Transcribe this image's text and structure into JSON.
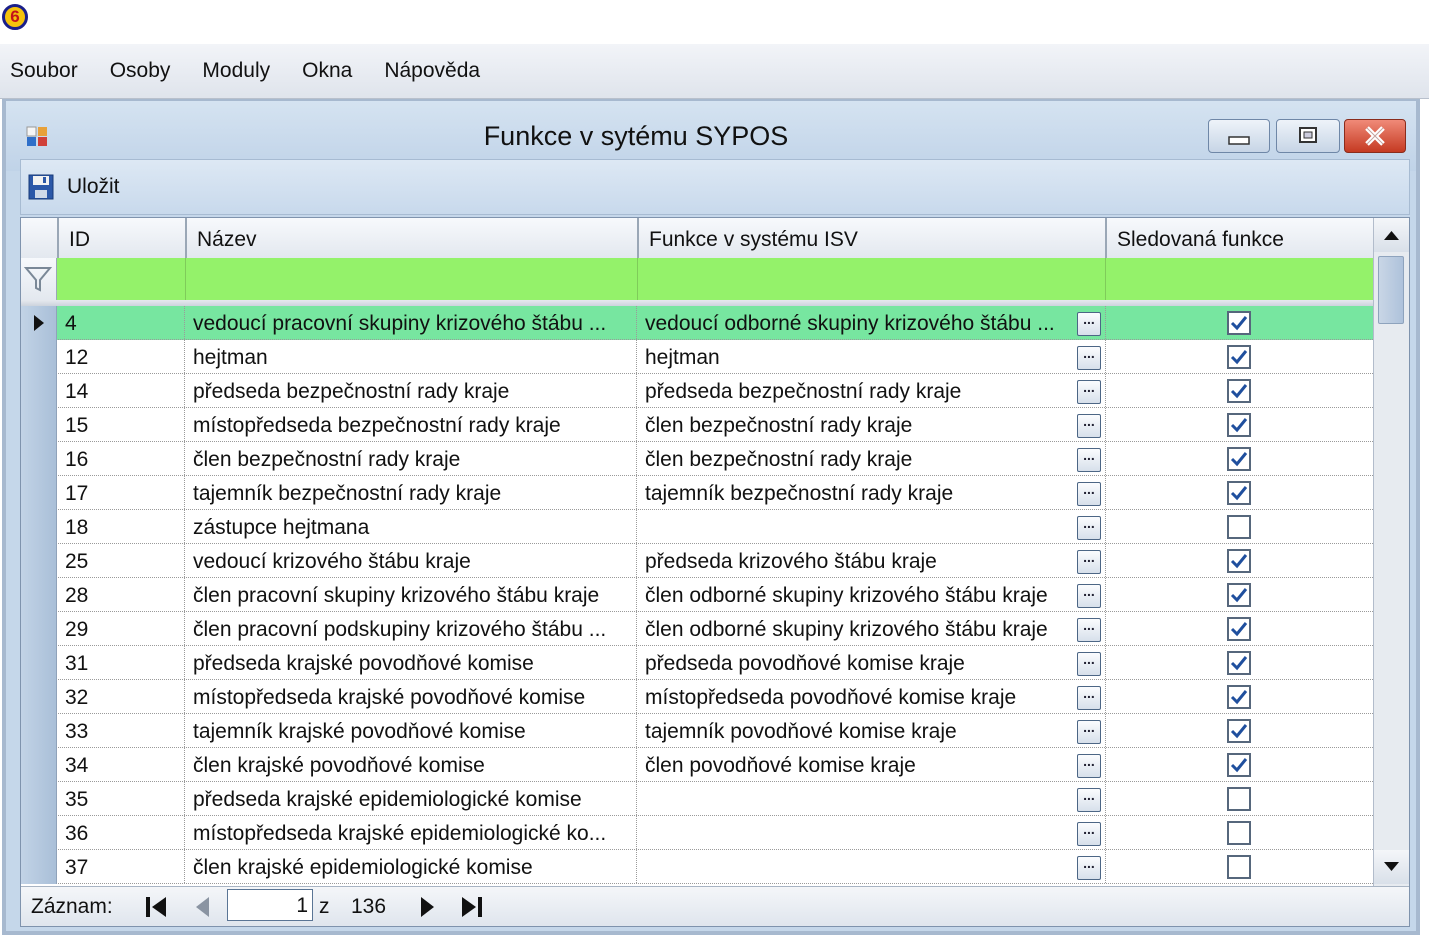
{
  "app": {
    "badge": "6"
  },
  "menu": [
    "Soubor",
    "Osoby",
    "Moduly",
    "Okna",
    "Nápověda"
  ],
  "window": {
    "title": "Funkce v sytému SYPOS"
  },
  "toolbar": {
    "save_label": "Uložit"
  },
  "grid": {
    "columns": [
      "ID",
      "Název",
      "Funkce v systému ISV",
      "Sledovaná funkce"
    ],
    "rows": [
      {
        "id": "4",
        "name": "vedoucí pracovní skupiny krizového štábu ...",
        "isv": "vedoucí odborné skupiny krizového štábu ...",
        "tracked": true,
        "selected": true
      },
      {
        "id": "12",
        "name": "hejtman",
        "isv": "hejtman",
        "tracked": true
      },
      {
        "id": "14",
        "name": "předseda bezpečnostní rady kraje",
        "isv": "předseda bezpečnostní rady kraje",
        "tracked": true
      },
      {
        "id": "15",
        "name": "místopředseda bezpečnostní rady kraje",
        "isv": "člen bezpečnostní rady kraje",
        "tracked": true
      },
      {
        "id": "16",
        "name": "člen bezpečnostní rady kraje",
        "isv": "člen bezpečnostní rady kraje",
        "tracked": true
      },
      {
        "id": "17",
        "name": "tajemník bezpečnostní rady kraje",
        "isv": "tajemník bezpečnostní rady kraje",
        "tracked": true
      },
      {
        "id": "18",
        "name": "zástupce hejtmana",
        "isv": "",
        "tracked": false
      },
      {
        "id": "25",
        "name": "vedoucí krizového štábu kraje",
        "isv": "předseda krizového štábu kraje",
        "tracked": true
      },
      {
        "id": "28",
        "name": "člen pracovní skupiny krizového štábu kraje",
        "isv": "člen odborné skupiny krizového štábu kraje",
        "tracked": true
      },
      {
        "id": "29",
        "name": "člen pracovní podskupiny krizového štábu ...",
        "isv": "člen odborné skupiny krizového štábu kraje",
        "tracked": true
      },
      {
        "id": "31",
        "name": "předseda krajské povodňové komise",
        "isv": "předseda povodňové komise kraje",
        "tracked": true
      },
      {
        "id": "32",
        "name": "místopředseda krajské povodňové komise",
        "isv": "místopředseda povodňové komise kraje",
        "tracked": true
      },
      {
        "id": "33",
        "name": "tajemník krajské povodňové komise",
        "isv": "tajemník povodňové komise kraje",
        "tracked": true
      },
      {
        "id": "34",
        "name": "člen krajské povodňové komise",
        "isv": "člen povodňové komise kraje",
        "tracked": true
      },
      {
        "id": "35",
        "name": "předseda krajské epidemiologické komise",
        "isv": "",
        "tracked": false
      },
      {
        "id": "36",
        "name": "místopředseda krajské epidemiologické ko...",
        "isv": "",
        "tracked": false
      },
      {
        "id": "37",
        "name": "člen krajské epidemiologické komise",
        "isv": "",
        "tracked": false
      }
    ],
    "ellipsis_label": "...",
    "filter_color": "#94f26a",
    "selected_color": "#77e6a0"
  },
  "navigator": {
    "label": "Záznam:",
    "position": "1",
    "of_label": "z",
    "count": "136"
  }
}
